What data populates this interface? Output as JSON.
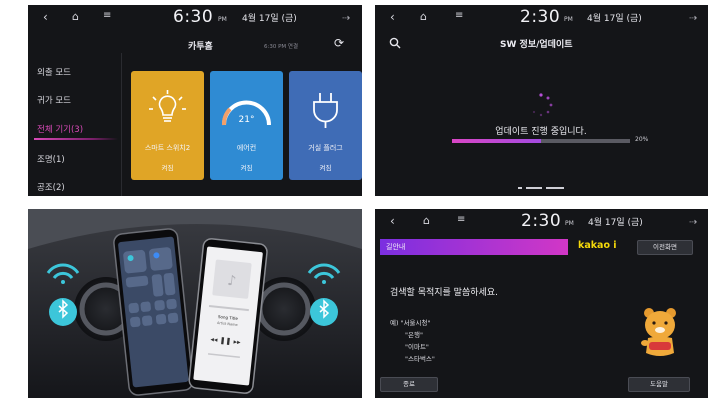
{
  "panel_home": {
    "status": {
      "time": "6:30",
      "ampm": "PM",
      "date": "4월 17일 (금)"
    },
    "title": "카투홈",
    "subtitle": "6:30 PM 연결",
    "sidebar": [
      {
        "label": "외출 모드",
        "active": false
      },
      {
        "label": "귀가 모드",
        "active": false
      },
      {
        "label": "전체 기기(3)",
        "active": true
      },
      {
        "label": "조명(1)",
        "active": false
      },
      {
        "label": "공조(2)",
        "active": false
      }
    ],
    "tiles": [
      {
        "label": "스마트 스위치2",
        "status": "켜짐",
        "color": "#e0a526"
      },
      {
        "label": "에어컨",
        "status": "켜짐",
        "temp": "21°",
        "color": "#2f8bd3"
      },
      {
        "label": "거실 플러그",
        "status": "켜짐",
        "color": "#3f6cb6"
      }
    ]
  },
  "panel_update": {
    "status": {
      "time": "2:30",
      "ampm": "PM",
      "date": "4월 17일 (금)"
    },
    "title": "SW 정보/업데이트",
    "message": "업데이트 진행 중입니다.",
    "percent_label": "20%",
    "progress": 0.5
  },
  "panel_phone": {
    "song_title": "Song Title",
    "artist": "Artist Name"
  },
  "panel_voice": {
    "status": {
      "time": "2:30",
      "ampm": "PM",
      "date": "4월 17일 (금)"
    },
    "bar_label": "길안내",
    "brand": "kakao i",
    "prev_button": "이전화면",
    "prompt": "검색할 목적지를 말씀하세요.",
    "examples": [
      "예) \"서울시청\"",
      "\"은행\"",
      "\"이마트\"",
      "\"스타벅스\""
    ],
    "end_button": "종료",
    "help_button": "도움말"
  },
  "colors": {
    "accent_pink": "#d94ab8",
    "kakao_yellow": "#f5d90a",
    "wifi_teal": "#3cc6da"
  }
}
